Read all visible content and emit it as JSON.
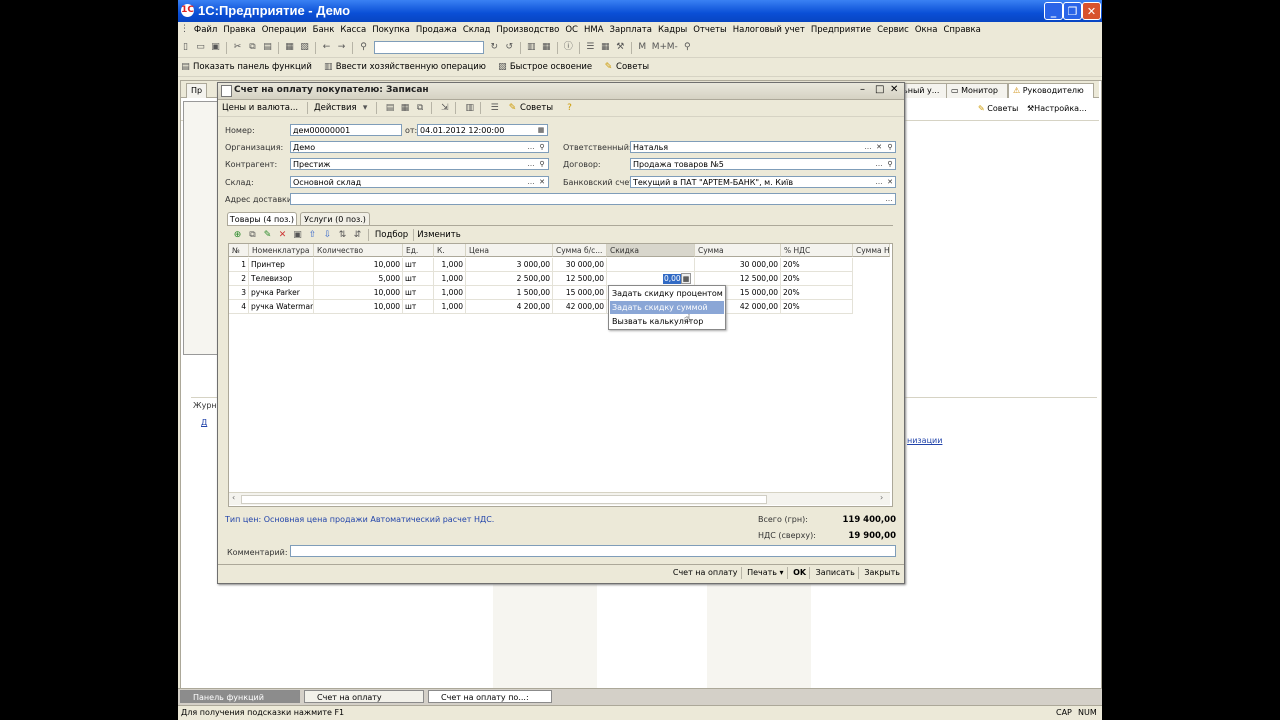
{
  "window": {
    "title": "1С:Предприятие - Демо",
    "logo": "1С"
  },
  "menu": [
    "Файл",
    "Правка",
    "Операции",
    "Банк",
    "Касса",
    "Покупка",
    "Продажа",
    "Склад",
    "Производство",
    "ОС",
    "НМА",
    "Зарплата",
    "Кадры",
    "Отчеты",
    "Налоговый учет",
    "Предприятие",
    "Сервис",
    "Окна",
    "Справка"
  ],
  "toolbar2": {
    "items": [
      "Показать панель функций",
      "Ввести хозяйственную операцию",
      "Быстрое освоение",
      "Советы"
    ]
  },
  "workspace_tabs": [
    "Пр",
    "ьный у...",
    "Монитор",
    "Руководителю"
  ],
  "workspace_right": {
    "tips": "Советы",
    "settings": "Настройка..."
  },
  "workspace_left": {
    "journal": "Журн",
    "link": "Д",
    "org_link": "низации"
  },
  "doc": {
    "title": "Счет на оплату покупателю: Записан",
    "toolbar": {
      "prices": "Цены и валюта...",
      "actions": "Действия",
      "tips": "Советы"
    },
    "labels": {
      "number": "Номер:",
      "from": "от:",
      "org": "Организация:",
      "responsible": "Ответственный:",
      "counterparty": "Контрагент:",
      "contract": "Договор:",
      "warehouse": "Склад:",
      "bank_account": "Банковский счет:",
      "delivery": "Адрес доставки:"
    },
    "values": {
      "number": "дем00000001",
      "date": "04.01.2012 12:00:00",
      "org": "Демо",
      "responsible": "Наталья",
      "counterparty": "Престиж",
      "contract": "Продажа товаров №5",
      "warehouse": "Основной склад",
      "bank_account": "Текущий в ПАТ \"АРТЕМ-БАНК\", м. Київ",
      "delivery": ""
    },
    "tabs": {
      "goods": "Товары (4 поз.)",
      "services": "Услуги (0 поз.)"
    },
    "grid_toolbar": {
      "pick": "Подбор",
      "change": "Изменить"
    },
    "columns": [
      "№",
      "Номенклатура",
      "Количество",
      "Ед.",
      "К.",
      "Цена",
      "Сумма б/с...",
      "Скидка",
      "Сумма",
      "% НДС",
      "Сумма Н"
    ],
    "rows": [
      {
        "n": "1",
        "name": "Принтер",
        "qty": "10,000",
        "unit": "шт",
        "k": "1,000",
        "price": "3 000,00",
        "sum_bs": "30 000,00",
        "disc": "",
        "sum": "30 000,00",
        "vat": "20%"
      },
      {
        "n": "2",
        "name": "Телевизор",
        "qty": "5,000",
        "unit": "шт",
        "k": "1,000",
        "price": "2 500,00",
        "sum_bs": "12 500,00",
        "disc": "0,00",
        "sum": "12 500,00",
        "vat": "20%"
      },
      {
        "n": "3",
        "name": "ручка Parker",
        "qty": "10,000",
        "unit": "шт",
        "k": "1,000",
        "price": "1 500,00",
        "sum_bs": "15 000,00",
        "disc": "",
        "sum": "15 000,00",
        "vat": "20%"
      },
      {
        "n": "4",
        "name": "ручка Waterman",
        "qty": "10,000",
        "unit": "шт",
        "k": "1,000",
        "price": "4 200,00",
        "sum_bs": "42 000,00",
        "disc": "",
        "sum": "42 000,00",
        "vat": "20%"
      }
    ],
    "popup": [
      "Задать скидку процентом",
      "Задать скидку суммой",
      "Вызвать калькулятор"
    ],
    "price_type": "Тип цен: Основная цена продажи Автоматический расчет НДС.",
    "totals": {
      "total_label": "Всего (грн):",
      "total": "119 400,00",
      "vat_label": "НДС (сверху):",
      "vat": "19 900,00"
    },
    "comment_label": "Комментарий:",
    "footer": {
      "invoice": "Счет на оплату",
      "print": "Печать",
      "ok": "OK",
      "save": "Записать",
      "close": "Закрыть"
    }
  },
  "taskbar": [
    "Панель функций",
    "Счет на оплату покупателю",
    "Счет на оплату по...: Записан"
  ],
  "status": {
    "hint": "Для получения подсказки нажмите F1",
    "cap": "CAP",
    "num": "NUM"
  }
}
